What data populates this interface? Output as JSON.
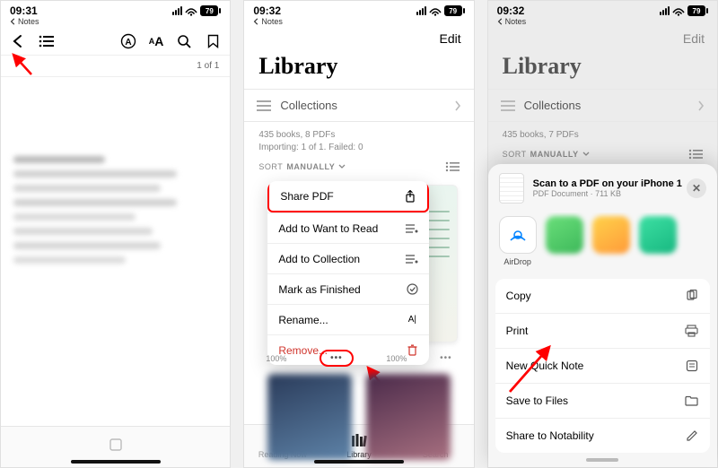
{
  "status": {
    "time_p1": "09:31",
    "time_p2": "09:32",
    "time_p3": "09:32",
    "battery": "79"
  },
  "breadcrumb": {
    "back_app": "Notes"
  },
  "screen1": {
    "page_indicator": "1 of 1",
    "icons": {
      "back": "chevron-left",
      "toc": "list-bullet",
      "appearance": "circle-a",
      "textsize": "AA",
      "search": "magnifier",
      "bookmark": "bookmark"
    }
  },
  "library": {
    "edit": "Edit",
    "title": "Library",
    "collections_label": "Collections",
    "meta_p2_line1": "435 books, 8 PDFs",
    "meta_p2_line2": "Importing: 1 of 1. Failed: 0",
    "meta_p3": "435 books, 7 PDFs",
    "sort_prefix": "SORT",
    "sort_value": "MANUALLY"
  },
  "context_menu": {
    "share_pdf": "Share PDF",
    "add_want": "Add to Want to Read",
    "add_collection": "Add to Collection",
    "mark_finished": "Mark as Finished",
    "rename": "Rename...",
    "remove": "Remove..."
  },
  "progress": {
    "left_pct": "100%",
    "right_pct": "100%",
    "dots": "•••"
  },
  "tabbar": {
    "reading_now": "Reading Now",
    "library": "Library",
    "search": "Search"
  },
  "share_sheet": {
    "doc_title": "Scan to a PDF on your iPhone 1",
    "doc_sub": "PDF Document · 711 KB",
    "airdrop": "AirDrop",
    "copy": "Copy",
    "print": "Print",
    "new_quick_note": "New Quick Note",
    "save_to_files": "Save to Files",
    "share_to_notability": "Share to Notability"
  }
}
